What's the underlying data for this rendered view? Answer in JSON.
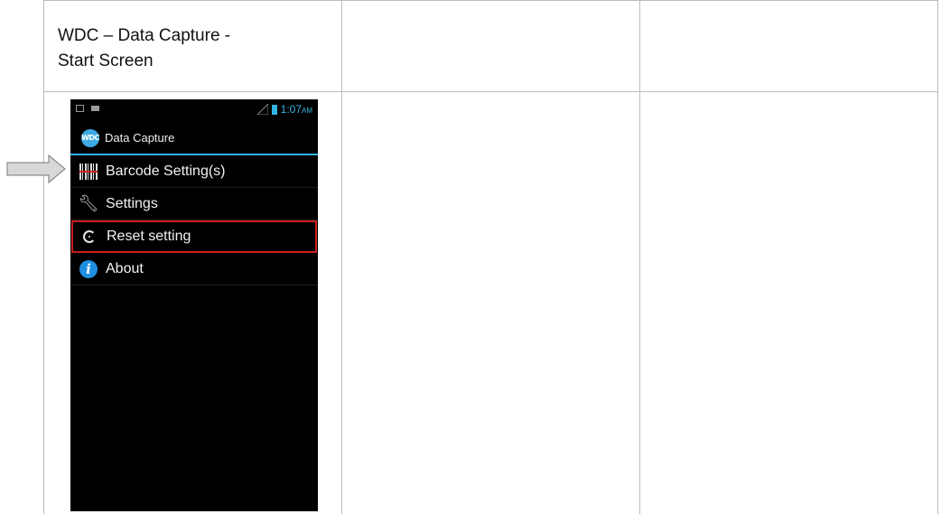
{
  "table": {
    "header_cell": "WDC – Data Capture -\nStart Screen"
  },
  "phone": {
    "status_time": "1:07",
    "status_ampm": "AM",
    "app_logo_text": "WDC",
    "app_title": "Data Capture",
    "menu": [
      {
        "label": "Barcode Setting(s)",
        "icon": "barcode-icon"
      },
      {
        "label": "Settings",
        "icon": "wrench-icon"
      },
      {
        "label": "Reset setting",
        "icon": "reset-icon",
        "highlighted": true
      },
      {
        "label": "About",
        "icon": "info-icon"
      }
    ],
    "accent_color": "#33b5e5",
    "highlight_color": "#c81e1e"
  }
}
